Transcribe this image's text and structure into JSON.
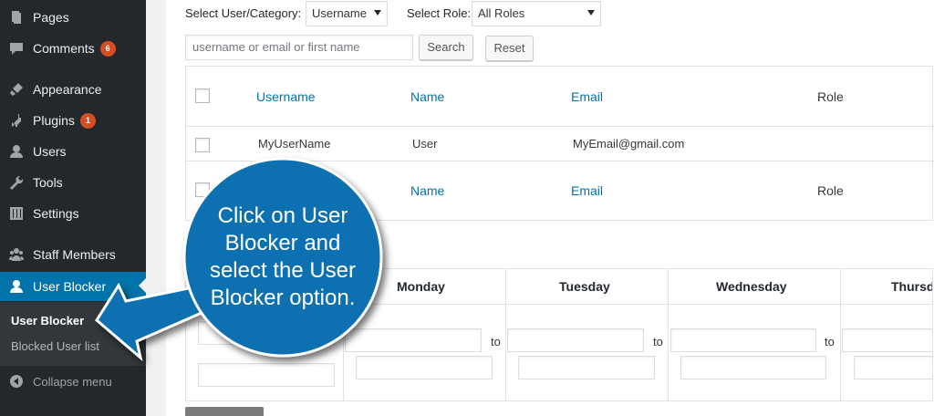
{
  "sidebar": {
    "items": [
      {
        "label": "Pages",
        "icon": "pages-icon"
      },
      {
        "label": "Comments",
        "icon": "comments-icon",
        "badge": "6"
      },
      {
        "label": "Appearance",
        "icon": "paintbrush-icon"
      },
      {
        "label": "Plugins",
        "icon": "plug-icon",
        "badge": "1"
      },
      {
        "label": "Users",
        "icon": "user-icon"
      },
      {
        "label": "Tools",
        "icon": "wrench-icon"
      },
      {
        "label": "Settings",
        "icon": "sliders-icon"
      },
      {
        "label": "Staff Members",
        "icon": "group-icon"
      },
      {
        "label": "User Blocker",
        "icon": "user-icon"
      }
    ],
    "submenu": [
      "User Blocker",
      "Blocked User list"
    ],
    "collapse": "Collapse menu"
  },
  "filters": {
    "user_category_label": "Select User/Category:",
    "user_category_value": "Username",
    "role_label": "Select Role:",
    "role_value": "All Roles",
    "search_placeholder": "username or email or first name",
    "search_button": "Search",
    "reset_button": "Reset"
  },
  "table": {
    "headers": [
      "Username",
      "Name",
      "Email",
      "Role"
    ],
    "rows": [
      {
        "username": "MyUserName",
        "name": "User",
        "email": "MyEmail@gmail.com",
        "role": ""
      }
    ],
    "footers": [
      "Name",
      "Email",
      "Role"
    ]
  },
  "schedule": {
    "days": [
      "Monday",
      "Tuesday",
      "Wednesday",
      "Thursd"
    ],
    "to_label": "to"
  },
  "callout": {
    "text": "Click on User Blocker and select the User Blocker option.",
    "color": "#0a6fb0"
  },
  "colors": {
    "sidebar_bg": "#23282d",
    "active": "#0073aa",
    "badge": "#d54e21",
    "link": "#0073aa"
  }
}
